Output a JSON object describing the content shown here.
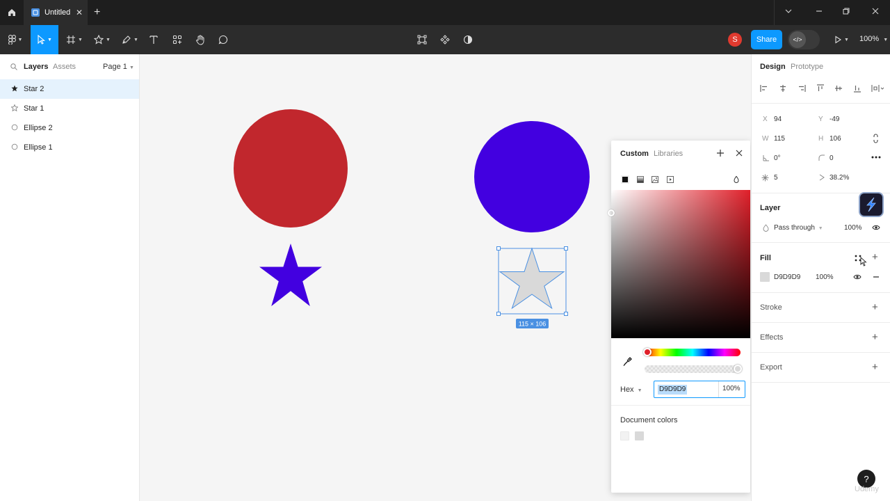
{
  "tab": {
    "title": "Untitled",
    "close": "✕",
    "new": "+"
  },
  "window": {
    "minimize_glyph": "—",
    "maximize_glyph": "❐",
    "close_glyph": "✕",
    "menu_glyph": "⌄"
  },
  "toolbar": {
    "avatar_initial": "S",
    "share_label": "Share",
    "dev_glyph": "</>",
    "zoom": "100%",
    "play_caret": "⌄"
  },
  "left_panel": {
    "tabs": {
      "layers": "Layers",
      "assets": "Assets",
      "page": "Page 1"
    },
    "layers": [
      {
        "name": "Star 2",
        "icon": "star-icon",
        "selected": true
      },
      {
        "name": "Star 1",
        "icon": "star-icon",
        "selected": false
      },
      {
        "name": "Ellipse 2",
        "icon": "ellipse-icon",
        "selected": false
      },
      {
        "name": "Ellipse 1",
        "icon": "ellipse-icon",
        "selected": false
      }
    ]
  },
  "canvas": {
    "selection_size": "115 × 106",
    "shapes": {
      "ellipse_left_color": "#c1272d",
      "ellipse_right_color": "#4200e0",
      "star_left_color": "#4200e0",
      "star_right_color": "#d9d9d9",
      "selection_color": "#4a90e2"
    }
  },
  "color_picker": {
    "tabs": {
      "custom": "Custom",
      "libraries": "Libraries"
    },
    "hex_label": "Hex",
    "hex_value": "D9D9D9",
    "opacity": "100%",
    "document_colors_label": "Document colors",
    "document_colors": [
      "#f2f2f2",
      "#d9d9d9"
    ]
  },
  "right_panel": {
    "tabs": {
      "design": "Design",
      "prototype": "Prototype"
    },
    "x_label": "X",
    "x_value": "94",
    "y_label": "Y",
    "y_value": "-49",
    "w_label": "W",
    "w_value": "115",
    "h_label": "H",
    "h_value": "106",
    "rotation": "0°",
    "corner_radius": "0",
    "count": "5",
    "ratio": "38.2%",
    "layer_title": "Layer",
    "blend_mode": "Pass through",
    "layer_opacity": "100%",
    "fill_title": "Fill",
    "fill_hex": "D9D9D9",
    "fill_opacity": "100%",
    "stroke_title": "Stroke",
    "effects_title": "Effects",
    "export_title": "Export"
  },
  "help": {
    "glyph": "?"
  },
  "watermark": "Udemy"
}
